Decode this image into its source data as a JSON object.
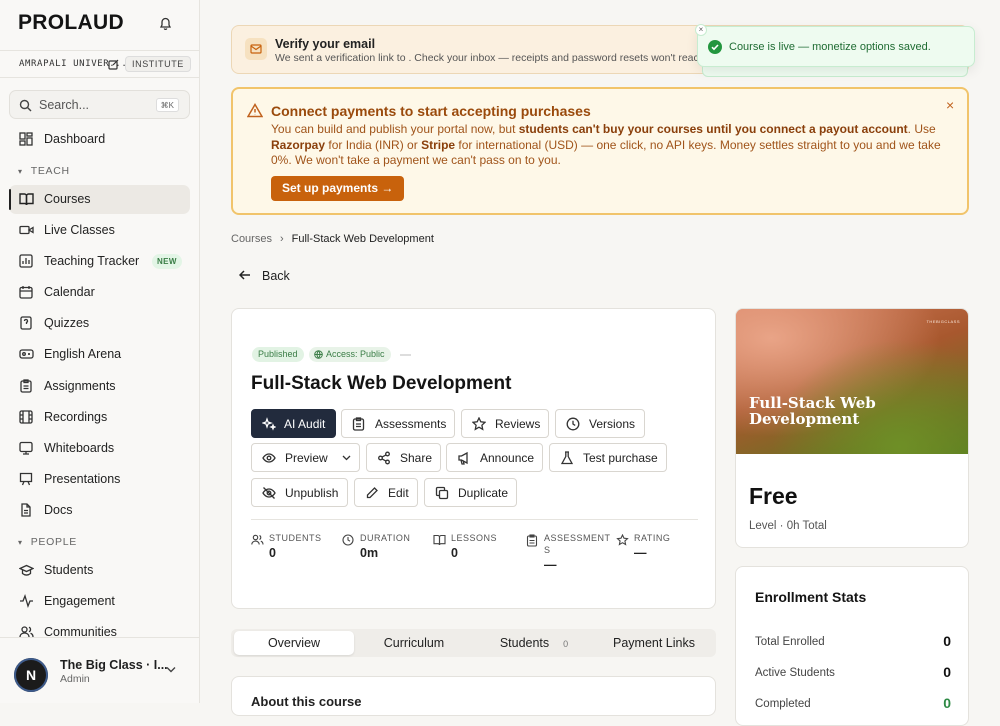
{
  "app": {
    "logo": "PROLAUD"
  },
  "org": {
    "name": "AMRAPALI UNIVER...",
    "badge": "INSTITUTE"
  },
  "search": {
    "placeholder": "Search...",
    "shortcut": "⌘K"
  },
  "sidebar": {
    "dashboard": "Dashboard",
    "teach_section": "TEACH",
    "teach": [
      {
        "label": "Courses",
        "icon": "book-icon",
        "active": true
      },
      {
        "label": "Live Classes",
        "icon": "video-icon"
      },
      {
        "label": "Teaching Tracker",
        "icon": "chart-icon",
        "badge": "NEW"
      },
      {
        "label": "Calendar",
        "icon": "calendar-icon"
      },
      {
        "label": "Quizzes",
        "icon": "quiz-icon"
      },
      {
        "label": "English Arena",
        "icon": "arena-icon"
      },
      {
        "label": "Assignments",
        "icon": "clipboard-icon"
      },
      {
        "label": "Recordings",
        "icon": "film-icon"
      },
      {
        "label": "Whiteboards",
        "icon": "whiteboard-icon"
      },
      {
        "label": "Presentations",
        "icon": "presentation-icon"
      },
      {
        "label": "Docs",
        "icon": "doc-icon"
      }
    ],
    "people_section": "PEOPLE",
    "people": [
      {
        "label": "Students",
        "icon": "graduation-cap-icon"
      },
      {
        "label": "Engagement",
        "icon": "activity-icon"
      },
      {
        "label": "Communities",
        "icon": "users-icon"
      }
    ]
  },
  "user": {
    "initial": "N",
    "name": "The Big Class · I...",
    "role": "Admin"
  },
  "verify": {
    "title": "Verify your email",
    "desc": "We sent a verification link to . Check your inbox — receipts and password resets won't reach yo"
  },
  "toast": {
    "message": "Course is live — monetize options saved.",
    "close": "×"
  },
  "payments": {
    "title": "Connect payments to start accepting purchases",
    "p1": "You can build and publish your portal now, but ",
    "b1": "students can't buy your courses until you connect a payout account",
    "p2": ". Use ",
    "b2": "Razorpay",
    "p3": " for India (INR) or ",
    "b3": "Stripe",
    "p4": "  for international (USD) — one click, no API keys. Money settles straight to you and we take 0%. We won't take a payment we can't pass on to you.",
    "cta": "Set up payments →",
    "close": "×"
  },
  "breadcrumb": {
    "root": "Courses",
    "current": "Full-Stack Web Development"
  },
  "back_label": "Back",
  "course": {
    "status": "Published",
    "access": "Access: Public",
    "title": "Full-Stack Web Development",
    "actions": {
      "ai_audit": "AI Audit",
      "assessments": "Assessments",
      "reviews": "Reviews",
      "versions": "Versions",
      "preview": "Preview",
      "share": "Share",
      "announce": "Announce",
      "test_purchase": "Test purchase",
      "unpublish": "Unpublish",
      "edit": "Edit",
      "duplicate": "Duplicate"
    },
    "stats": {
      "students": {
        "label": "STUDENTS",
        "value": "0"
      },
      "duration": {
        "label": "DURATION",
        "value": "0m"
      },
      "lessons": {
        "label": "LESSONS",
        "value": "0"
      },
      "assessments": {
        "label1": "ASSESSMENT",
        "label2": "S",
        "value": "—"
      },
      "rating": {
        "label": "RATING",
        "value": "—"
      }
    }
  },
  "tabs": {
    "overview": "Overview",
    "curriculum": "Curriculum",
    "students": "Students",
    "students_count": "0",
    "payment_links": "Payment Links"
  },
  "about": {
    "title": "About this course"
  },
  "preview_card": {
    "brand": "THEBIGCLASS",
    "thumb_title": "Full-Stack Web Development",
    "price": "Free",
    "meta": "Level · 0h Total"
  },
  "enrollment": {
    "title": "Enrollment Stats",
    "total_label": "Total Enrolled",
    "total": "0",
    "active_label": "Active Students",
    "active": "0",
    "completed_label": "Completed",
    "completed": "0"
  },
  "colors": {
    "accent": "#c8620c",
    "dark_button": "#222b3d",
    "success": "#2e8a45"
  }
}
